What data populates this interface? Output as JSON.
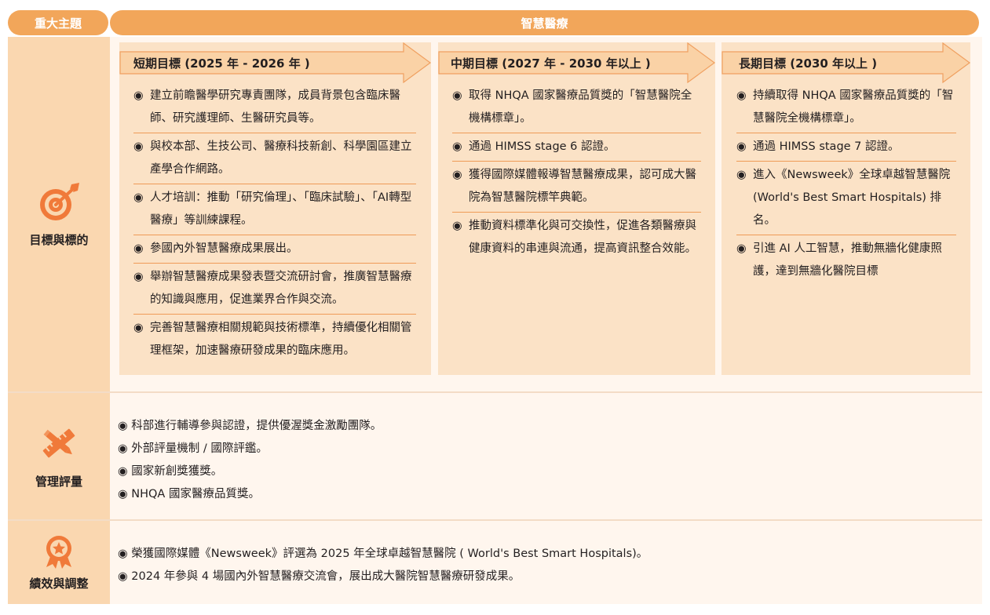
{
  "header": {
    "theme_label": "重大主題",
    "topic": "智慧醫療"
  },
  "bullet": "◉",
  "rows": {
    "goals": {
      "label": "目標與標的",
      "icon": "target-icon",
      "columns": [
        {
          "title": "短期目標 (2025 年 - 2026 年 )",
          "items": [
            "建立前瞻醫學研究專責團隊，成員背景包含臨床醫師、研究護理師、生醫研究員等。",
            "與校本部、生技公司、醫療科技新創、科學園區建立產學合作網路。",
            "人才培訓：推動「研究倫理」、「臨床試驗」、「AI轉型醫療」等訓練課程。",
            "參國內外智慧醫療成果展出。",
            "舉辦智慧醫療成果發表暨交流研討會，推廣智慧醫療的知識與應用，促進業界合作與交流。",
            "完善智慧醫療相關規範與技術標準，持續優化相關管理框架，加速醫療研發成果的臨床應用。"
          ]
        },
        {
          "title": "中期目標 (2027 年 - 2030 年以上 )",
          "items": [
            "取得 NHQA 國家醫療品質獎的「智慧醫院全機構標章」。",
            "通過 HIMSS stage 6 認證。",
            "獲得國際媒體報導智慧醫療成果，認可成大醫院為智慧醫院標竿典範。",
            "推動資料標準化與可交換性，促進各類醫療與健康資料的串連與流通，提高資訊整合效能。"
          ]
        },
        {
          "title": "長期目標 (2030 年以上 )",
          "items": [
            "持續取得 NHQA 國家醫療品質獎的「智慧醫院全機構標章」。",
            "通過 HIMSS stage 7 認證。",
            "進入《Newsweek》全球卓越智慧醫院 (World's Best Smart Hospitals) 排名。",
            "引進 AI 人工智慧，推動無牆化健康照護，達到無牆化醫院目標"
          ]
        }
      ]
    },
    "management": {
      "label": "管理評量",
      "icon": "pencil-ruler-icon",
      "items": [
        "科部進行輔導參與認證，提供優渥獎金激勵團隊。",
        "外部評量機制 / 國際評鑑。",
        "國家新創獎獲獎。",
        "NHQA 國家醫療品質獎。"
      ]
    },
    "performance": {
      "label": "績效與調整",
      "icon": "award-medal-icon",
      "items": [
        "榮獲國際媒體《Newsweek》評選為 2025 年全球卓越智慧醫院 ( World's Best Smart Hospitals)。",
        "2024 年參與 4 場國內外智慧醫療交流會，展出成大醫院智慧醫療研發成果。"
      ]
    }
  },
  "colors": {
    "accent": "#f2a65a",
    "label_bg": "#fad7b0",
    "content_bg": "#fff6ee",
    "column_bg": "#fbe2c6",
    "icon": "#f07a3a",
    "divider": "#ef9b57"
  }
}
